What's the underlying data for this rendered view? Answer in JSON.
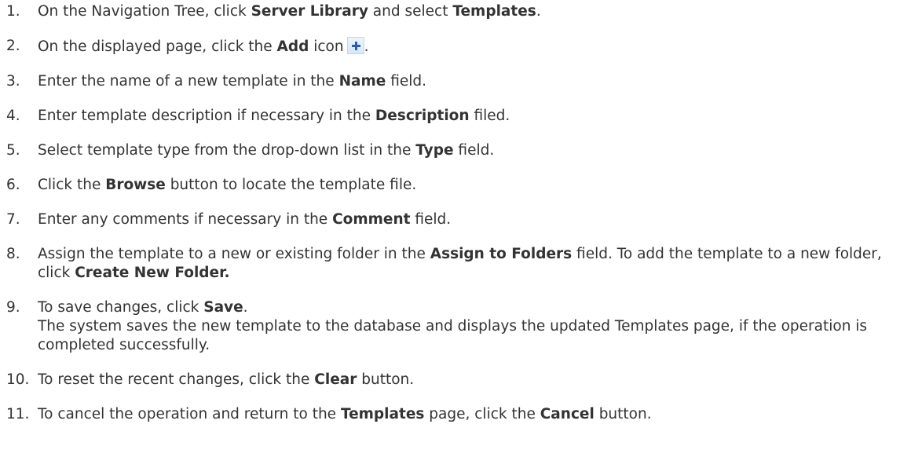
{
  "steps": [
    {
      "num": "1.",
      "t1": "On the Navigation Tree, click ",
      "b1": "Server Library",
      "t2": " and select ",
      "b2": "Templates",
      "t3": "."
    },
    {
      "num": "2.",
      "t1": "On the displayed page, click the ",
      "b1": "Add",
      "t2": " icon",
      "icon": "add-plus-icon",
      "t3": "."
    },
    {
      "num": "3.",
      "t1": "Enter the name of a new template in the ",
      "b1": "Name",
      "t2": " field."
    },
    {
      "num": "4.",
      "t1": "Enter template description if necessary in the ",
      "b1": "Description",
      "t2": " filed."
    },
    {
      "num": "5.",
      "t1": "Select template type from the drop-down list in the ",
      "b1": "Type",
      "t2": " field."
    },
    {
      "num": "6.",
      "t1": "Click the ",
      "b1": "Browse",
      "t2": " button to locate the template file."
    },
    {
      "num": "7.",
      "t1": "Enter any comments if necessary in the ",
      "b1": "Comment",
      "t2": " field."
    },
    {
      "num": "8.",
      "t1": "Assign the template to a new or existing folder in the ",
      "b1": "Assign to Folders",
      "t2": " field. To add the template to a new folder, click ",
      "b2": "Create New Folder."
    },
    {
      "num": "9.",
      "t1": "To save changes, click ",
      "b1": "Save",
      "t2": ".",
      "t3": "The system saves the new template to the database and displays the updated Templates page, if the operation is completed successfully."
    },
    {
      "num": "10.",
      "t1": "To reset the recent changes, click the ",
      "b1": "Clear",
      "t2": " button."
    },
    {
      "num": "11.",
      "t1": "To cancel the operation and return to the ",
      "b1": "Templates",
      "t2": " page, click the ",
      "b2": "Cancel",
      "t3": " button."
    }
  ]
}
